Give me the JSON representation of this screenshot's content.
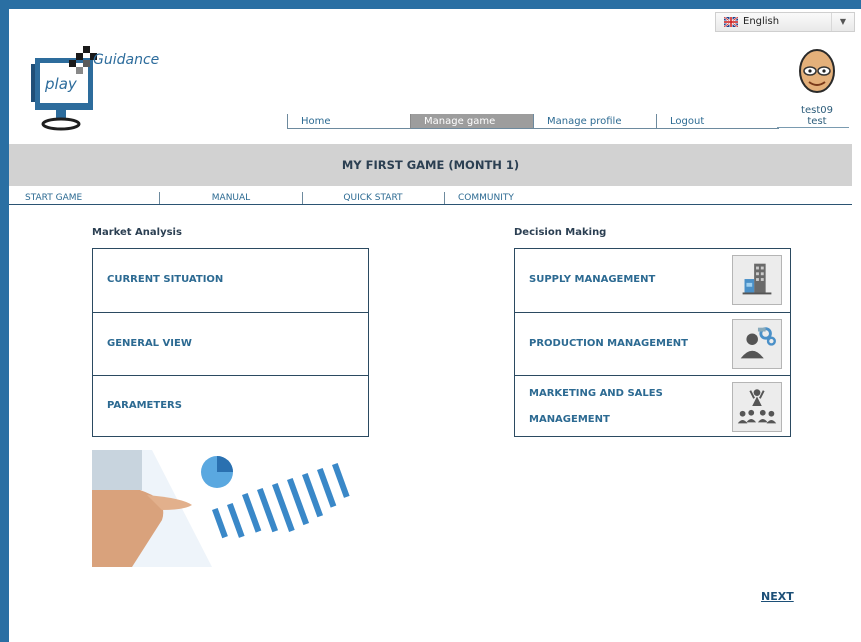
{
  "brand": {
    "logo_play": "play",
    "logo_word": "Guidance"
  },
  "language": {
    "selected": "English",
    "flag": "uk-flag-icon"
  },
  "user": {
    "username": "test09",
    "name": "test"
  },
  "nav": [
    {
      "label": "Home"
    },
    {
      "label": "Manage game",
      "active": true
    },
    {
      "label": "Manage profile"
    },
    {
      "label": "Logout"
    }
  ],
  "game": {
    "title": "MY FIRST GAME (MONTH 1)"
  },
  "tabs": [
    {
      "label": "START GAME"
    },
    {
      "label": "MANUAL"
    },
    {
      "label": "QUICK START"
    },
    {
      "label": "COMMUNITY"
    }
  ],
  "market": {
    "heading": "Market Analysis",
    "items": [
      {
        "label": "CURRENT SITUATION"
      },
      {
        "label": "GENERAL VIEW"
      },
      {
        "label": "PARAMETERS"
      }
    ]
  },
  "decision": {
    "heading": "Decision Making",
    "items": [
      {
        "label": "SUPPLY MANAGEMENT",
        "icon": "warehouse-icon"
      },
      {
        "label": "PRODUCTION MANAGEMENT",
        "icon": "manager-gears-icon"
      },
      {
        "label_line1": "MARKETING AND SALES",
        "label_line2": "MANAGEMENT",
        "icon": "audience-presenter-icon"
      }
    ]
  },
  "footer": {
    "next": "NEXT"
  },
  "colors": {
    "frame": "#2a6fa3",
    "accent_text": "#2c6a92",
    "bar": "#d2d2d2",
    "active_tab": "#9d9d9d"
  }
}
